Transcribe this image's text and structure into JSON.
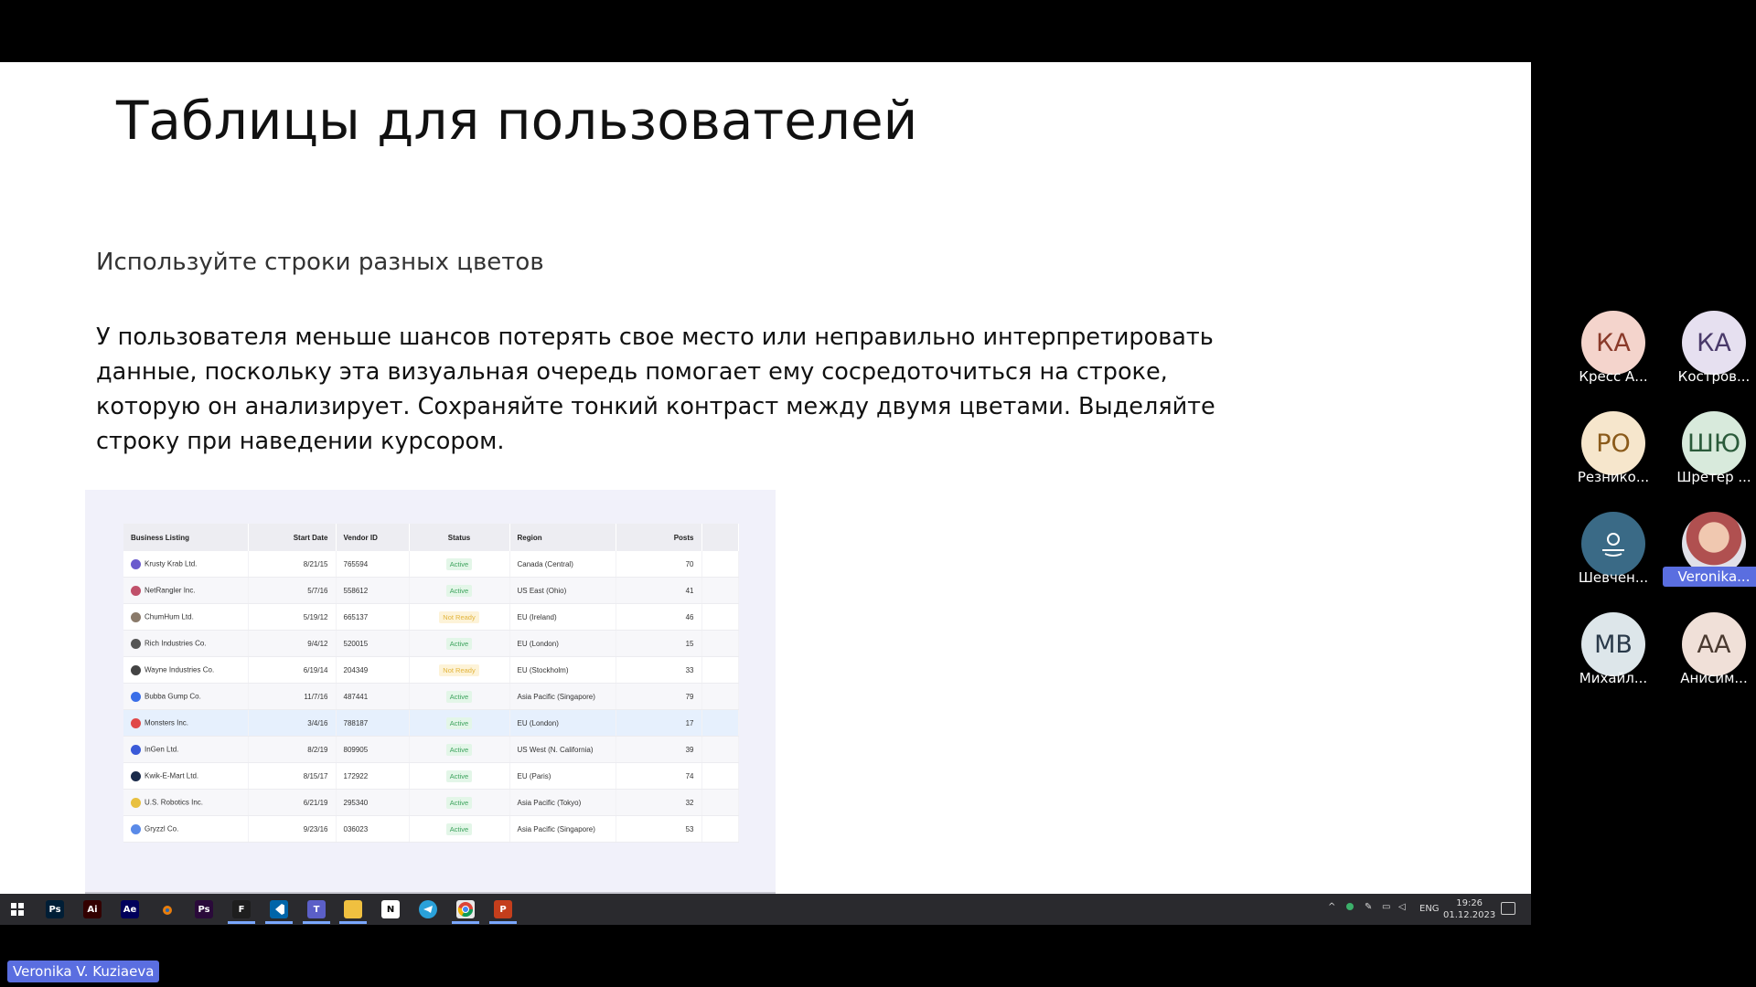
{
  "slide": {
    "title": "Таблицы для пользователей",
    "subtitle": "Используйте строки разных цветов",
    "body": "У пользователя меньше шансов потерять свое место или неправильно интерпретировать данные, поскольку эта визуальная очередь помогает ему сосредоточиться на строке, которую он анализирует. Сохраняйте тонкий контраст между двумя цветами. Выделяйте строку при наведении курсором."
  },
  "table": {
    "headers": [
      "Business Listing",
      "Start Date",
      "Vendor ID",
      "Status",
      "Region",
      "Posts"
    ],
    "rows": [
      {
        "name": "Krusty Krab Ltd.",
        "date": "8/21/15",
        "vendor": "765594",
        "status": "Active",
        "region": "Canada (Central)",
        "posts": "70",
        "icon_color": "#6a5acd"
      },
      {
        "name": "NetRangler Inc.",
        "date": "5/7/16",
        "vendor": "558612",
        "status": "Active",
        "region": "US East (Ohio)",
        "posts": "41",
        "icon_color": "#c0506a"
      },
      {
        "name": "ChumHum Ltd.",
        "date": "5/19/12",
        "vendor": "665137",
        "status": "Not Ready",
        "region": "EU (Ireland)",
        "posts": "46",
        "icon_color": "#8a7a6a"
      },
      {
        "name": "Rich Industries Co.",
        "date": "9/4/12",
        "vendor": "520015",
        "status": "Active",
        "region": "EU (London)",
        "posts": "15",
        "icon_color": "#555"
      },
      {
        "name": "Wayne Industries Co.",
        "date": "6/19/14",
        "vendor": "204349",
        "status": "Not Ready",
        "region": "EU (Stockholm)",
        "posts": "33",
        "icon_color": "#444"
      },
      {
        "name": "Bubba Gump Co.",
        "date": "11/7/16",
        "vendor": "487441",
        "status": "Active",
        "region": "Asia Pacific (Singapore)",
        "posts": "79",
        "icon_color": "#3a6ee8"
      },
      {
        "name": "Monsters Inc.",
        "date": "3/4/16",
        "vendor": "788187",
        "status": "Active",
        "region": "EU (London)",
        "posts": "17",
        "icon_color": "#e04848"
      },
      {
        "name": "InGen Ltd.",
        "date": "8/2/19",
        "vendor": "809905",
        "status": "Active",
        "region": "US West (N. California)",
        "posts": "39",
        "icon_color": "#3a5ad8"
      },
      {
        "name": "Kwik-E-Mart Ltd.",
        "date": "8/15/17",
        "vendor": "172922",
        "status": "Active",
        "region": "EU (Paris)",
        "posts": "74",
        "icon_color": "#1a2a4a"
      },
      {
        "name": "U.S. Robotics Inc.",
        "date": "6/21/19",
        "vendor": "295340",
        "status": "Active",
        "region": "Asia Pacific (Tokyo)",
        "posts": "32",
        "icon_color": "#e8c040"
      },
      {
        "name": "Gryzzl Co.",
        "date": "9/23/16",
        "vendor": "036023",
        "status": "Active",
        "region": "Asia Pacific (Singapore)",
        "posts": "53",
        "icon_color": "#5a8ae8"
      }
    ],
    "hover_row": 6
  },
  "participants": [
    {
      "initials": "КА",
      "name": "Кресс А...",
      "bg": "#f4d4cc",
      "fg": "#8a3a2a"
    },
    {
      "initials": "КА",
      "name": "Костров...",
      "bg": "#e6e0f0",
      "fg": "#4a3a6a"
    },
    {
      "initials": "РО",
      "name": "Резнико...",
      "bg": "#f6e6cc",
      "fg": "#8a5a1a"
    },
    {
      "initials": "ШЮ",
      "name": "Шретер ...",
      "bg": "#d8eadc",
      "fg": "#2a5a3a"
    },
    {
      "initials": "",
      "name": "Шевчен...",
      "bg": "#3a6a86",
      "fg": "#ffffff",
      "icon": "person-icon"
    },
    {
      "initials": "",
      "name": "Veronika...",
      "bg": "#d0a890",
      "fg": "#ffffff",
      "icon": "photo-avatar",
      "highlight": true
    },
    {
      "initials": "МВ",
      "name": "Михайл...",
      "bg": "#dde6ea",
      "fg": "#2a3a4a"
    },
    {
      "initials": "АА",
      "name": "Анисим...",
      "bg": "#f0e0d8",
      "fg": "#4a3a30"
    }
  ],
  "taskbar": {
    "apps": [
      {
        "name": "windows-start-icon",
        "label": "",
        "color": "#2a2a2e"
      },
      {
        "name": "photoshop-icon",
        "label": "Ps",
        "color": "#001e36"
      },
      {
        "name": "illustrator-icon",
        "label": "Ai",
        "color": "#330000"
      },
      {
        "name": "after-effects-icon",
        "label": "Ae",
        "color": "#00005b"
      },
      {
        "name": "blender-icon",
        "label": "",
        "color": "#2a2a2e"
      },
      {
        "name": "premiere-icon",
        "label": "Ps",
        "color": "#2a0a3a"
      },
      {
        "name": "figma-icon",
        "label": "F",
        "color": "#1e1e1e"
      },
      {
        "name": "vscode-icon",
        "label": "",
        "color": "#0065a9"
      },
      {
        "name": "teams-icon",
        "label": "T",
        "color": "#5b5fc7"
      },
      {
        "name": "file-explorer-icon",
        "label": "",
        "color": "#f0c040"
      },
      {
        "name": "notion-icon",
        "label": "N",
        "color": "#ffffff"
      },
      {
        "name": "telegram-icon",
        "label": "",
        "color": "#2aa1da"
      },
      {
        "name": "chrome-icon",
        "label": "",
        "color": "#e8e8e8"
      },
      {
        "name": "powerpoint-icon",
        "label": "P",
        "color": "#c43e1c"
      }
    ],
    "lang": "ENG",
    "time": "19:26",
    "date": "01.12.2023"
  },
  "speaker": "Veronika V. Kuziaeva",
  "accent": "#5a6ee0"
}
